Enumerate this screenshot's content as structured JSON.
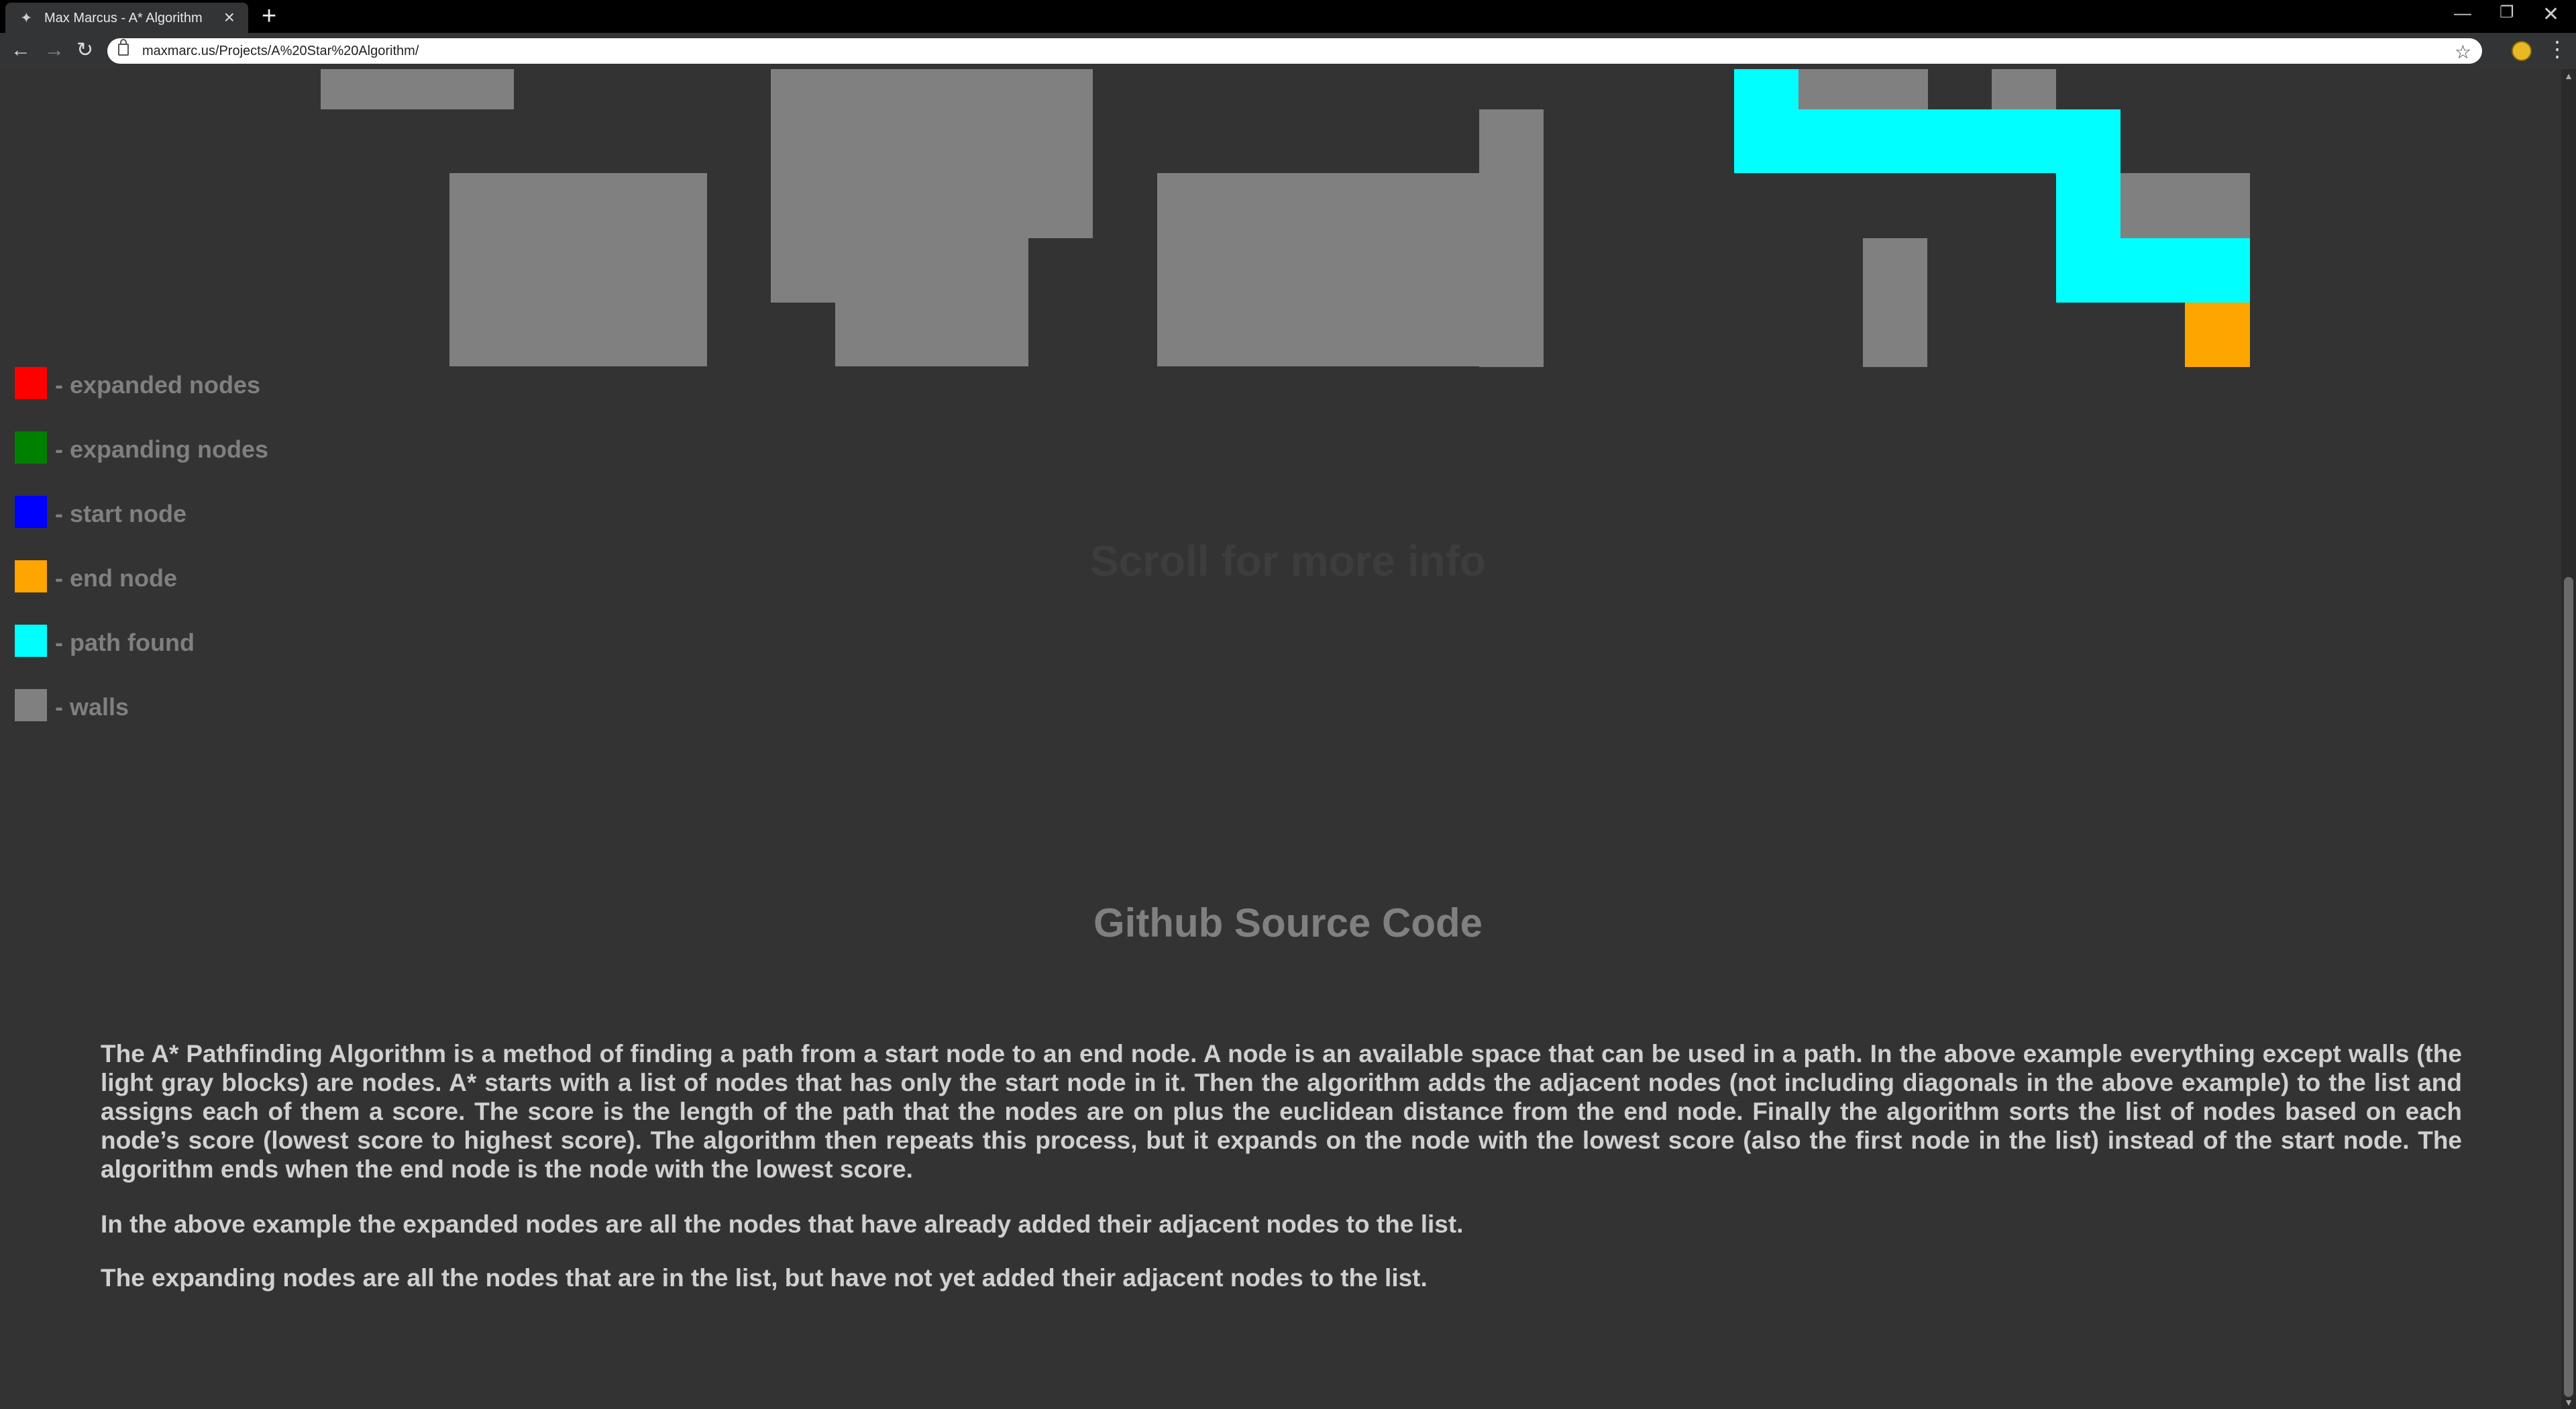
{
  "browser": {
    "tab_title": "Max Marcus - A* Algorithm",
    "url": "maxmarc.us/Projects/A%20Star%20Algorithm/"
  },
  "colors": {
    "expanded": "#ff0000",
    "expanding": "#008000",
    "start": "#0000ff",
    "end": "#ffa500",
    "path": "#00ffff",
    "walls": "#808080",
    "background": "#333333"
  },
  "legend": [
    {
      "label": "- expanded nodes",
      "color": "#ff0000"
    },
    {
      "label": "- expanding nodes",
      "color": "#008000"
    },
    {
      "label": "- start node",
      "color": "#0000ff"
    },
    {
      "label": "- end node",
      "color": "#ffa500"
    },
    {
      "label": "- path found",
      "color": "#00ffff"
    },
    {
      "label": "- walls",
      "color": "#808080"
    }
  ],
  "scroll_message": "Scroll for more info",
  "github_link": "Github Source Code",
  "info": {
    "paragraph1": "The A* Pathfinding Algorithm is a method of finding a path from a start node to an end node.  A node is an available space that can be used in a path. In the above example everything except walls (the light gray blocks) are nodes. A* starts with a list of nodes that has only the start node in it. Then the algorithm adds the adjacent nodes (not including diagonals in the above example) to the list and assigns each of them a score. The score is the length of the path that the nodes are on plus the euclidean distance from the end node. Finally the algorithm sorts the list of nodes based on each node’s score (lowest score to highest score). The algorithm then repeats this process, but it expands on the node with the lowest score (also the first node in the list) instead of the start node. The algorithm ends when the end node is the node with the lowest score.",
    "paragraph2": "In the above example the expanded nodes are all the nodes that have already added their adjacent nodes to the list.",
    "paragraph3": "The expanding nodes are all the nodes that are in the list, but have not yet added their adjacent nodes to the list."
  }
}
